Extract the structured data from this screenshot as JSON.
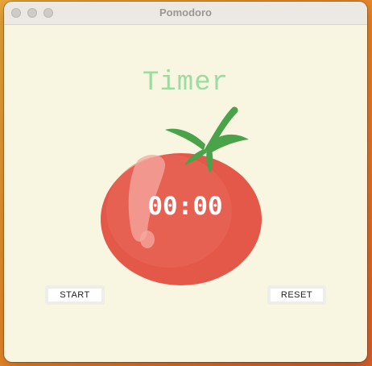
{
  "window": {
    "title": "Pomodoro"
  },
  "heading": "Timer",
  "timer": {
    "display": "00:00"
  },
  "buttons": {
    "start_label": "START",
    "reset_label": "RESET"
  },
  "colors": {
    "background": "#f8f6e0",
    "heading": "#9bdca1",
    "tomato": "#e4584a",
    "leaf": "#4aa24a",
    "timer_text": "#ffffff"
  },
  "icons": {
    "tomato": "tomato-image"
  }
}
